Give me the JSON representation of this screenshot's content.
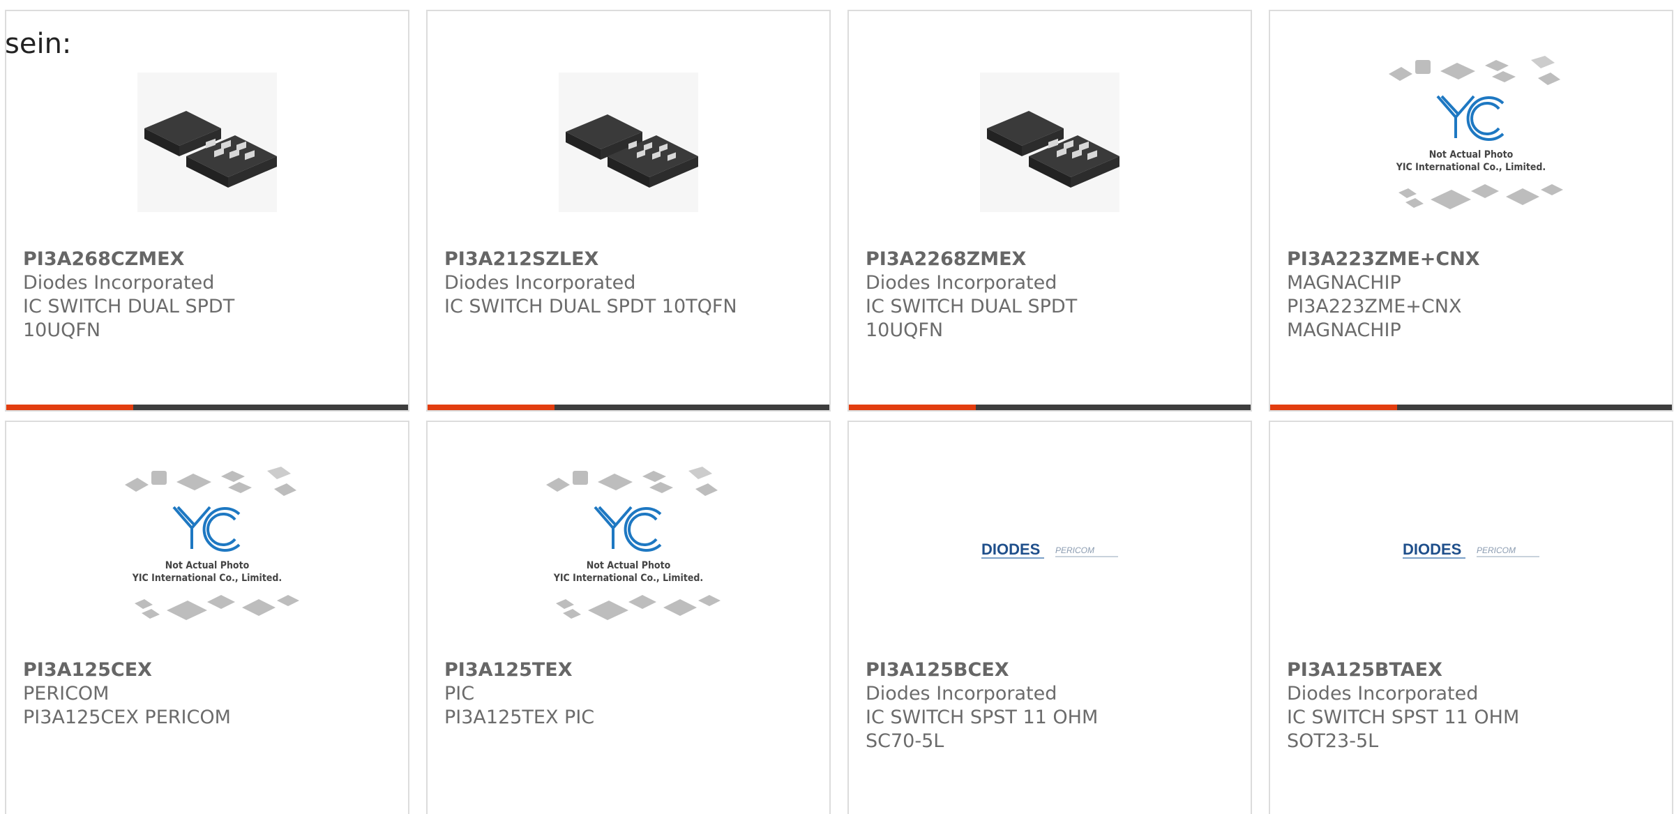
{
  "fragment_text": "sein:",
  "colors": {
    "accent": "#e23d0f",
    "bar": "#3d3d3d",
    "border": "#dcdcdc"
  },
  "products": [
    {
      "part": "PI3A268CZMEX",
      "manufacturer": "Diodes Incorporated",
      "description": "IC SWITCH DUAL SPDT 10UQFN",
      "image": "qfn-chip-photo"
    },
    {
      "part": "PI3A212SZLEX",
      "manufacturer": "Diodes Incorporated",
      "description": "IC SWITCH DUAL SPDT 10TQFN",
      "image": "qfn-chip-photo"
    },
    {
      "part": "PI3A2268ZMEX",
      "manufacturer": "Diodes Incorporated",
      "description": "IC SWITCH DUAL SPDT 10UQFN",
      "image": "qfn-chip-photo"
    },
    {
      "part": "PI3A223ZME+CNX",
      "manufacturer": "MAGNACHIP",
      "description": "PI3A223ZME+CNX MAGNACHIP",
      "image": "yic-placeholder"
    },
    {
      "part": "PI3A125CEX",
      "manufacturer": "PERICOM",
      "description": "PI3A125CEX PERICOM",
      "image": "yic-placeholder"
    },
    {
      "part": "PI3A125TEX",
      "manufacturer": "PIC",
      "description": "PI3A125TEX PIC",
      "image": "yic-placeholder"
    },
    {
      "part": "PI3A125BCEX",
      "manufacturer": "Diodes Incorporated",
      "description": "IC SWITCH SPST 11 OHM SC70-5L",
      "image": "diodes-pericom-logo"
    },
    {
      "part": "PI3A125BTAEX",
      "manufacturer": "Diodes Incorporated",
      "description": "IC SWITCH SPST 11 OHM SOT23-5L",
      "image": "diodes-pericom-logo"
    }
  ],
  "placeholder": {
    "brand": "YIC",
    "line1": "Not Actual Photo",
    "line2": "YIC International Co., Limited."
  },
  "logo": {
    "diodes": "DIODES",
    "pericom": "PERICOM"
  }
}
